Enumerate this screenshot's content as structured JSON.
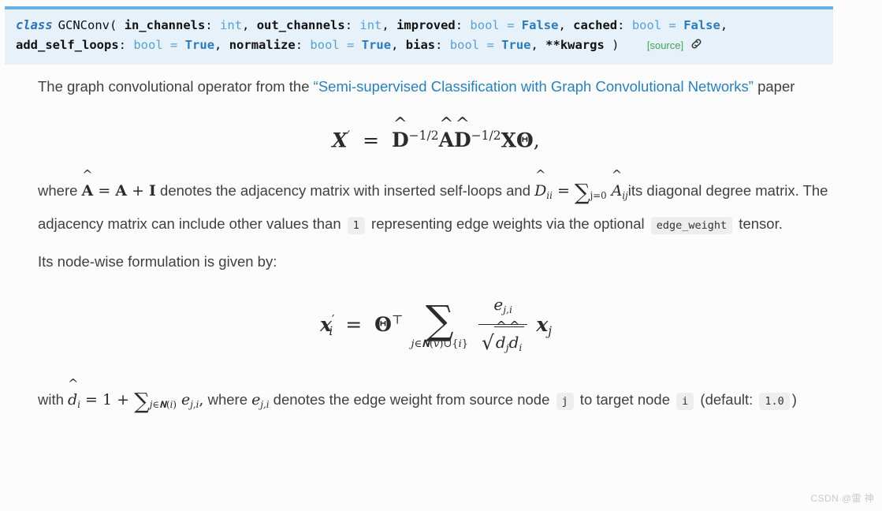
{
  "signature": {
    "keyword": "class",
    "class_name": "GCNConv",
    "open_paren": "(",
    "close_paren": ")",
    "params": [
      {
        "name": "in_channels",
        "colon": ":",
        "type": "int",
        "sep": ","
      },
      {
        "name": "out_channels",
        "colon": ":",
        "type": "int",
        "sep": ","
      },
      {
        "name": "improved",
        "colon": ":",
        "type": "bool",
        "eq": "=",
        "value": "False",
        "sep": ","
      },
      {
        "name": "cached",
        "colon": ":",
        "type": "bool",
        "eq": "=",
        "value": "False",
        "sep": ","
      },
      {
        "name": "add_self_loops",
        "colon": ":",
        "type": "bool",
        "eq": "=",
        "value": "True",
        "sep": ","
      },
      {
        "name": "normalize",
        "colon": ":",
        "type": "bool",
        "eq": "=",
        "value": "True",
        "sep": ","
      },
      {
        "name": "bias",
        "colon": ":",
        "type": "bool",
        "eq": "=",
        "value": "True",
        "sep": ","
      },
      {
        "name": "**kwargs",
        "colon": "",
        "type": "",
        "sep": ""
      }
    ],
    "source_label": "[source]",
    "permalink_icon": "chain-link-icon",
    "accent_border": "#6ab0de",
    "background": "#e7f1f9",
    "source_color": "#3fa45b"
  },
  "intro": {
    "text_before": "The graph convolutional operator from the ",
    "link_text": "“Semi-supervised Classification with Graph Convolutional Networks”",
    "text_after": " paper",
    "link_color": "#2980b9"
  },
  "equation_main": {
    "lhs": "X′",
    "rhs": "D̂⁻¹ᐟ² Â D̂⁻¹ᐟ² X Θ,",
    "latex": "\\mathbf{X}' = \\hat{\\mathbf{D}}^{-1/2} \\hat{\\mathbf{A}} \\hat{\\mathbf{D}}^{-1/2} \\mathbf{X} \\mathbf{\\Theta},"
  },
  "para_where": {
    "seg1": "where ",
    "math1": "Â = A + I",
    "seg2": " denotes the adjacency matrix with inserted self-loops and ",
    "math2": "D̂ᵢᵢ = Σⱼ₌₀ Âᵢⱼ",
    "seg3": "its diagonal degree matrix. The adjacency matrix can include other values than ",
    "code1": "1",
    "seg4": " representing edge weights via the optional ",
    "code2": "edge_weight",
    "seg5": " tensor."
  },
  "para_nodewise": {
    "text": "Its node-wise formulation is given by:"
  },
  "equation_nodewise": {
    "latex": "\\mathbf{x}'_i = \\mathbf{\\Theta}^{\\top} \\sum_{j \\in \\mathcal{N}(v) \\cup \\{i\\}} \\frac{e_{j,i}}{\\sqrt{\\hat{d}_j \\hat{d}_i}} \\mathbf{x}_j",
    "lhs": "x′ᵢ",
    "theta_transpose": "Θᵀ",
    "sum_limits": "j∈N(v)∪{i}",
    "numerator": "e_{j,i}",
    "denominator": "√(d̂ⱼ d̂ᵢ)",
    "trailing": "xⱼ"
  },
  "para_with": {
    "seg1": "with ",
    "math1": "d̂ᵢ = 1 + Σⱼ∈N(i) eⱼ,ᵢ,",
    "seg2": " where ",
    "math2": "eⱼ,ᵢ",
    "seg3": " denotes the edge weight from source node ",
    "code_j": "j",
    "seg4": " to target node ",
    "code_i": "i",
    "seg5": " (default: ",
    "code_default": "1.0",
    "seg6": ")"
  },
  "watermark": {
    "text": "CSDN @雷 神"
  }
}
